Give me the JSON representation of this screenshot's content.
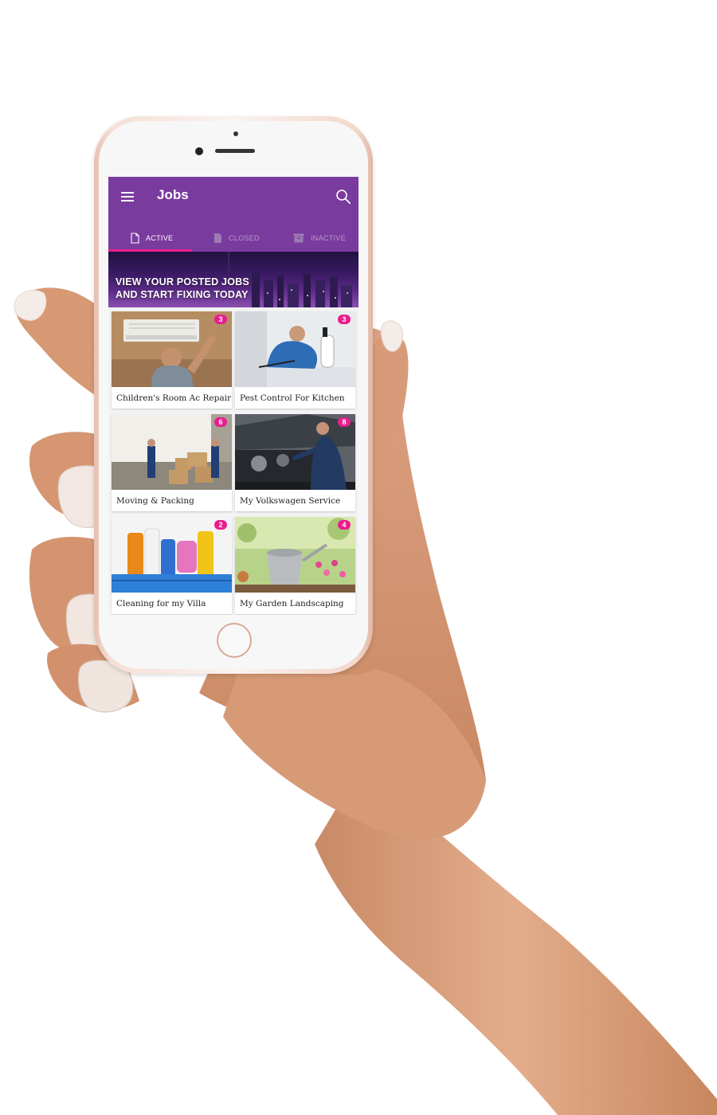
{
  "app": {
    "title": "Jobs"
  },
  "tabs": [
    {
      "label": "ACTIVE",
      "icon": "document-icon",
      "active": true
    },
    {
      "label": "CLOSED",
      "icon": "document-filled-icon",
      "active": false
    },
    {
      "label": "INACTIVE",
      "icon": "archive-icon",
      "active": false
    }
  ],
  "banner": {
    "text": "VIEW YOUR POSTED JOBS\nAND START FIXING TODAY"
  },
  "jobs": [
    {
      "title": "Children's Room Ac Repair",
      "count": "3",
      "image": "ac-repair-photo"
    },
    {
      "title": "Pest Control For Kitchen",
      "count": "3",
      "image": "pest-control-photo"
    },
    {
      "title": "Moving & Packing",
      "count": "6",
      "image": "moving-photo"
    },
    {
      "title": "My Volkswagen Service",
      "count": "8",
      "image": "car-service-photo"
    },
    {
      "title": "Cleaning for my Villa",
      "count": "2",
      "image": "cleaning-photo"
    },
    {
      "title": "My Garden Landscaping",
      "count": "4",
      "image": "garden-photo"
    }
  ],
  "colors": {
    "appbar": "#7a3b9f",
    "accent": "#e91e8c",
    "tab_inactive": "#b69ac7"
  }
}
